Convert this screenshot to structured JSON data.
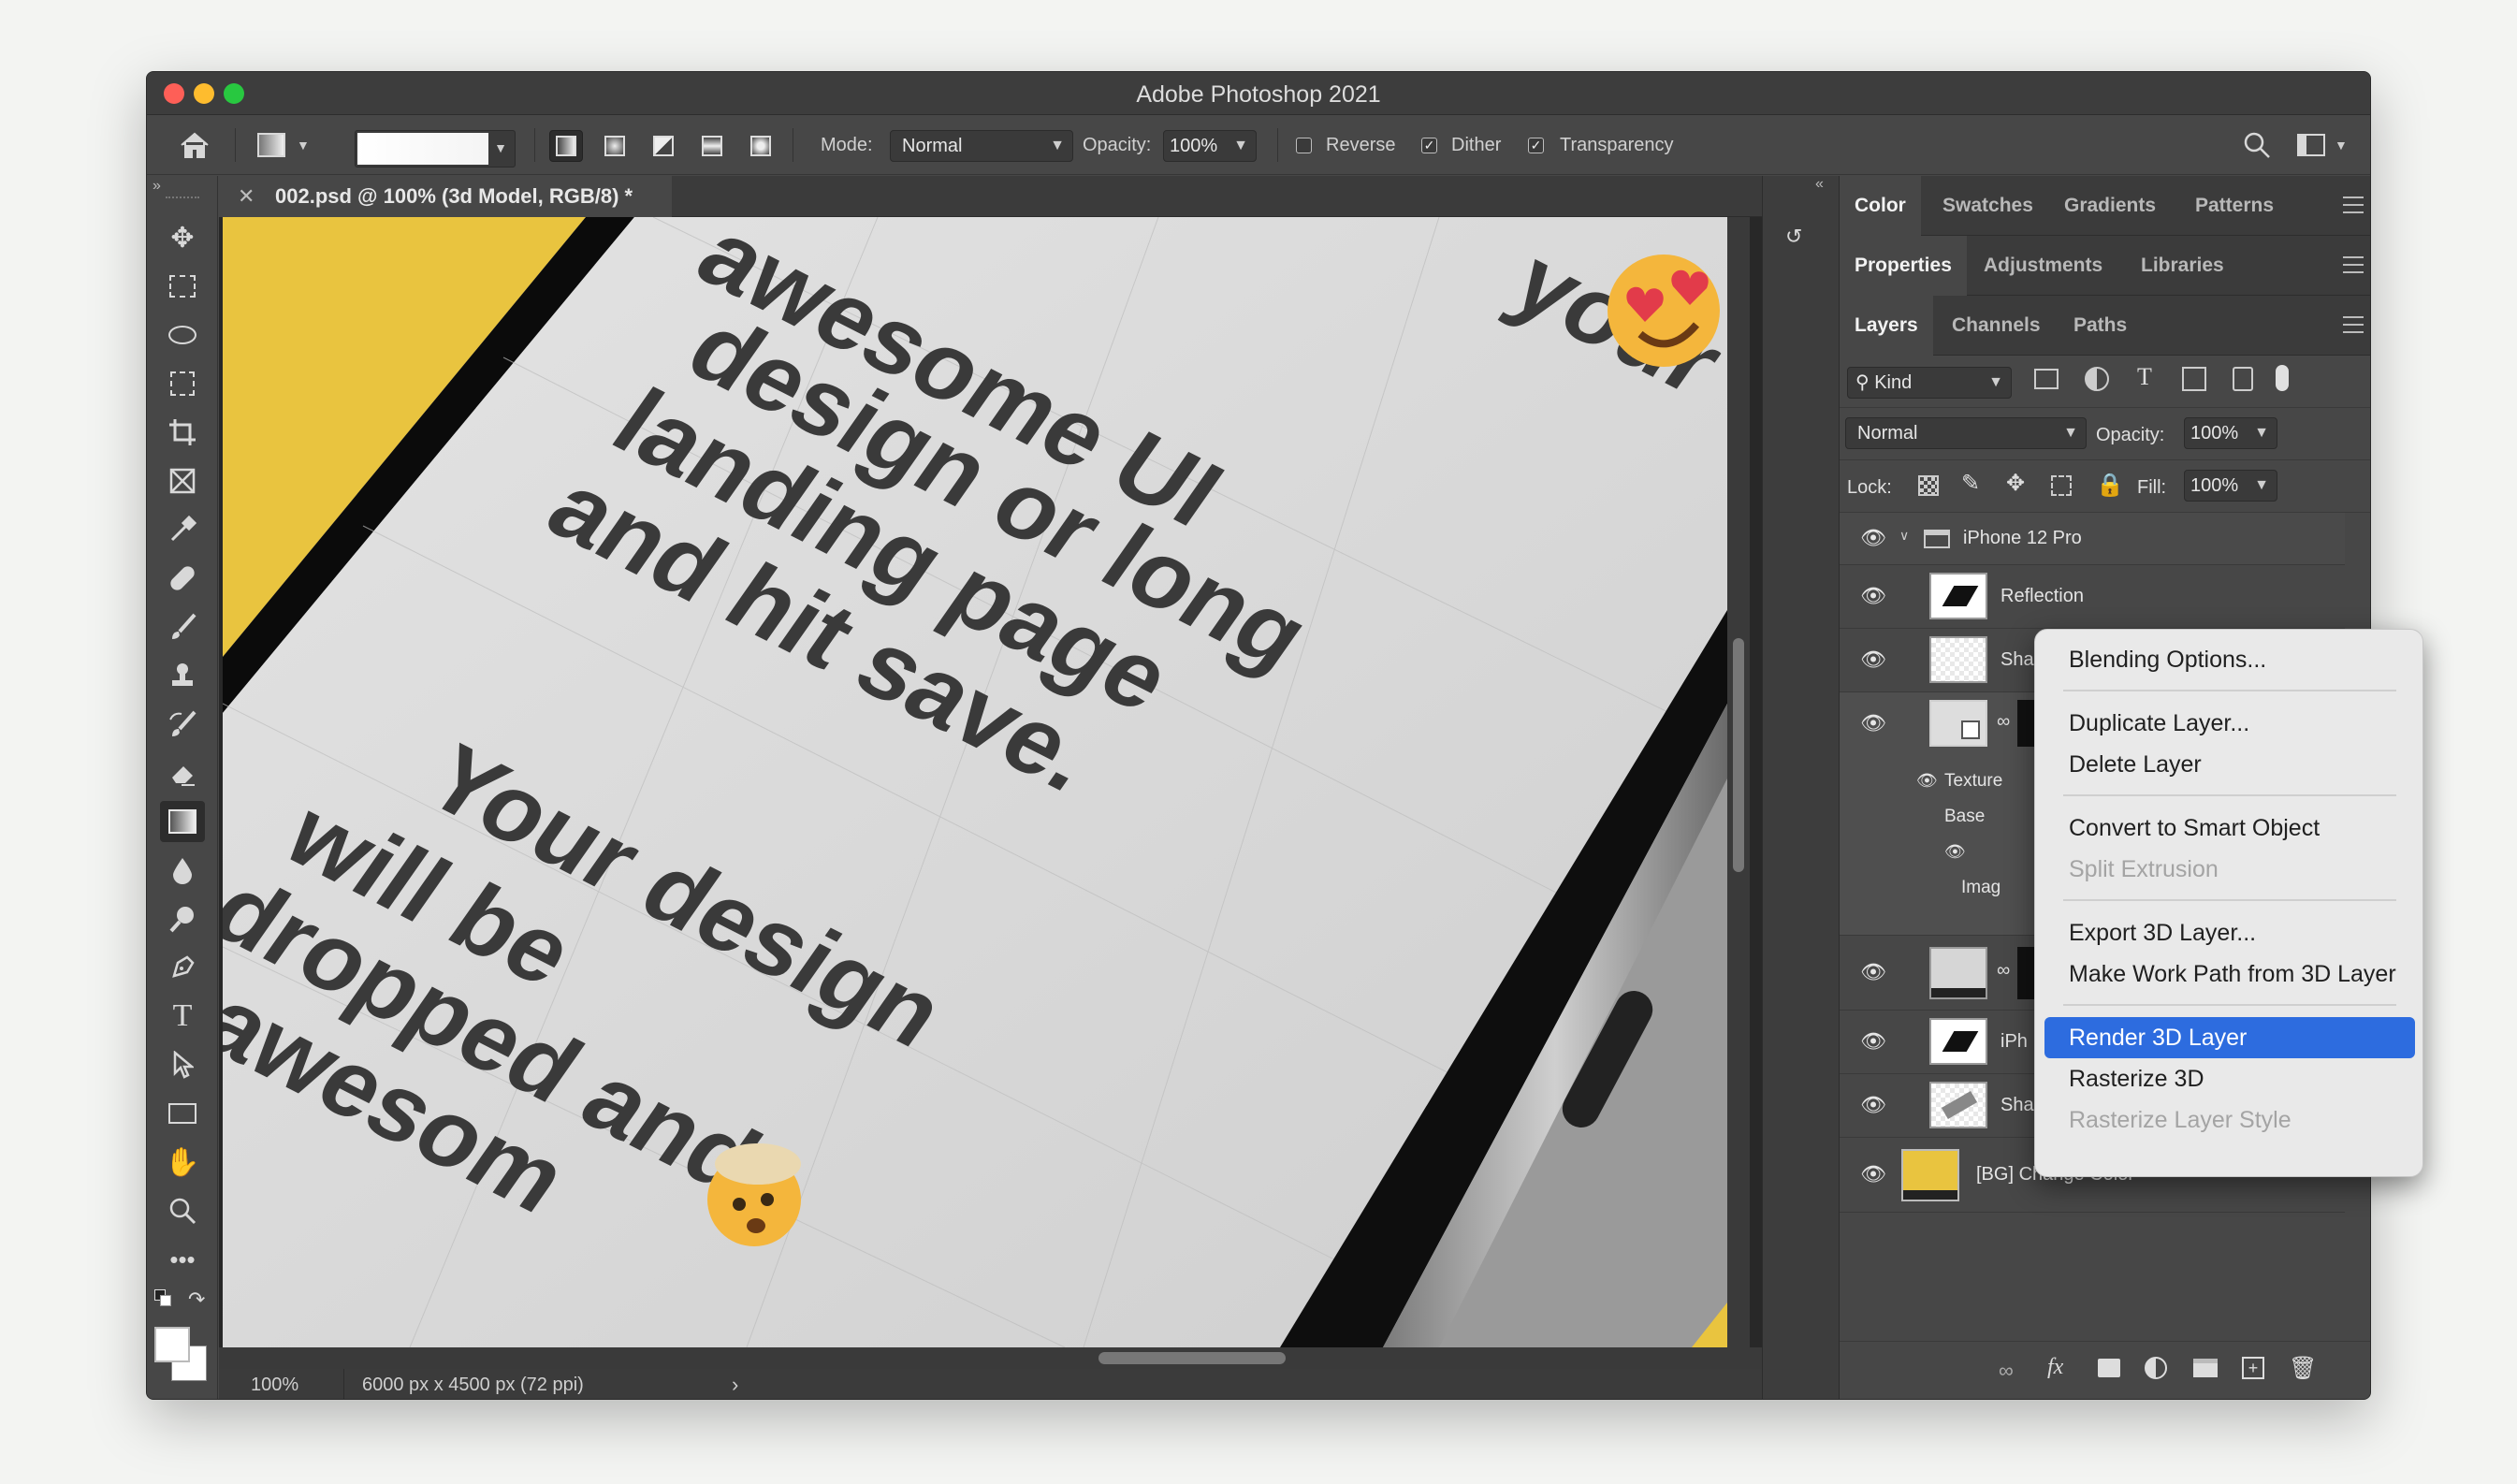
{
  "window": {
    "title": "Adobe Photoshop 2021"
  },
  "options_bar": {
    "mode_label": "Mode:",
    "mode_value": "Normal",
    "opacity_label": "Opacity:",
    "opacity_value": "100%",
    "reverse_label": "Reverse",
    "reverse_checked": false,
    "dither_label": "Dither",
    "dither_checked": true,
    "transparency_label": "Transparency",
    "transparency_checked": true
  },
  "tools": [
    "move-tool",
    "marquee-tool",
    "lasso-tool",
    "quick-selection-tool",
    "crop-tool",
    "frame-tool",
    "eyedropper-tool",
    "healing-brush-tool",
    "brush-tool",
    "clone-stamp-tool",
    "history-brush-tool",
    "eraser-tool",
    "gradient-tool",
    "blur-tool",
    "dodge-tool",
    "pen-tool",
    "type-tool",
    "path-selection-tool",
    "rectangle-tool",
    "hand-tool",
    "zoom-tool",
    "more-tools"
  ],
  "document": {
    "tab_title": "002.psd @ 100% (3d Model, RGB/8) *",
    "zoom": "100%",
    "info": "6000 px x 4500 px (72 ppi)"
  },
  "canvas_text": {
    "line1": "awesome UI",
    "line2": "design or long",
    "line3": "landing page",
    "line4": "and hit save.",
    "line5": "Your design",
    "line6": "will be",
    "line7": "dropped and",
    "line8": "awesom",
    "line0": "your"
  },
  "panels": {
    "top_tabs": [
      "Color",
      "Swatches",
      "Gradients",
      "Patterns"
    ],
    "mid_tabs": [
      "Properties",
      "Adjustments",
      "Libraries"
    ],
    "layer_tabs": [
      "Layers",
      "Channels",
      "Paths"
    ],
    "filter_kind": "Kind",
    "blend_mode": "Normal",
    "opacity_label": "Opacity:",
    "opacity_value": "100%",
    "lock_label": "Lock:",
    "fill_label": "Fill:",
    "fill_value": "100%"
  },
  "layers": {
    "group": "iPhone 12 Pro",
    "reflection": "Reflection",
    "sha1": "Sha",
    "sub_texture": "Texture",
    "sub_base": "Base",
    "sub_image": "Imag",
    "iph": "iPh",
    "sha2": "Sha",
    "bg": "[BG] Change Color",
    "bg_color": "#e9c43f"
  },
  "context_menu": {
    "items": [
      {
        "label": "Blending Options...",
        "disabled": false
      },
      {
        "label": "Duplicate Layer...",
        "disabled": false
      },
      {
        "label": "Delete Layer",
        "disabled": false
      },
      {
        "label": "Convert to Smart Object",
        "disabled": false
      },
      {
        "label": "Split Extrusion",
        "disabled": true
      },
      {
        "label": "Export 3D Layer...",
        "disabled": false
      },
      {
        "label": "Make Work Path from 3D Layer",
        "disabled": false
      },
      {
        "label": "Render 3D Layer",
        "disabled": false,
        "highlighted": true
      },
      {
        "label": "Rasterize 3D",
        "disabled": false
      },
      {
        "label": "Rasterize Layer Style",
        "disabled": true
      }
    ]
  },
  "colors": {
    "accent": "#2d6cdf",
    "canvas_bg_yellow": "#e9c43f"
  }
}
